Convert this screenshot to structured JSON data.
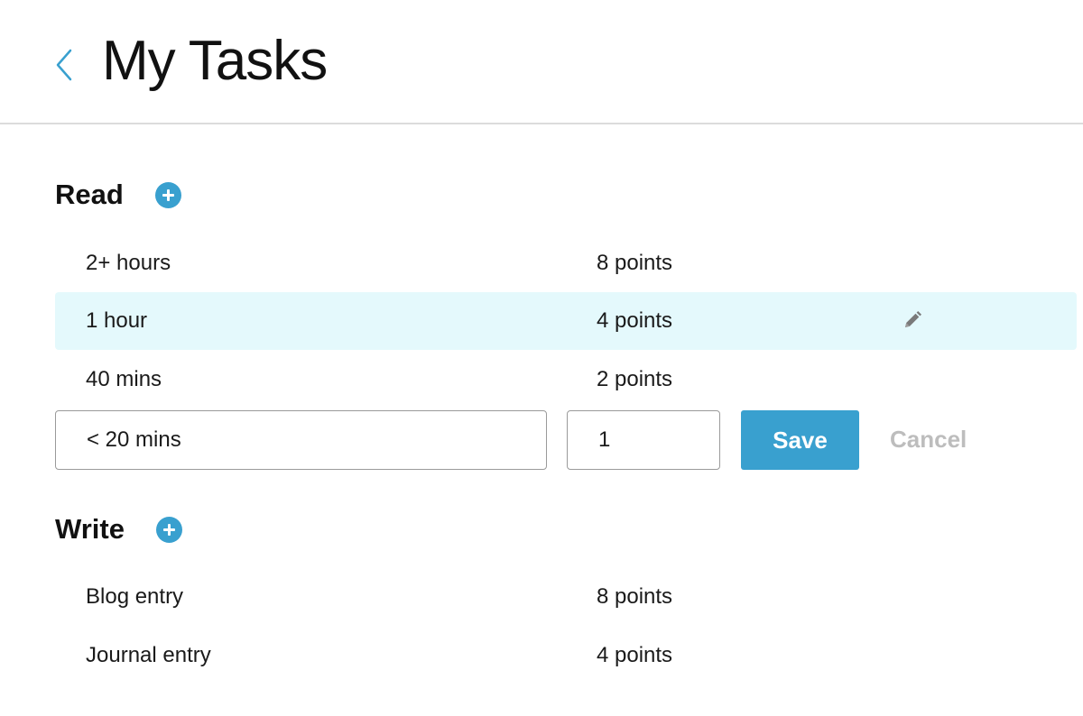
{
  "header": {
    "title": "My Tasks",
    "back_icon": "chevron-left-icon",
    "accent_color": "#39a0cf"
  },
  "sections": [
    {
      "title": "Read",
      "add_icon": "plus-circle-icon",
      "tasks": [
        {
          "name": "2+ hours",
          "points": "8 points"
        },
        {
          "name": "1 hour",
          "points": "4 points",
          "highlighted": true,
          "edit_icon": "pencil-icon"
        },
        {
          "name": "40 mins",
          "points": "2 points"
        }
      ],
      "editor": {
        "name_value": "< 20 mins",
        "points_value": "1",
        "save_label": "Save",
        "cancel_label": "Cancel"
      }
    },
    {
      "title": "Write",
      "add_icon": "plus-circle-icon",
      "tasks": [
        {
          "name": "Blog entry",
          "points": "8 points"
        },
        {
          "name": "Journal entry",
          "points": "4 points"
        }
      ]
    }
  ]
}
